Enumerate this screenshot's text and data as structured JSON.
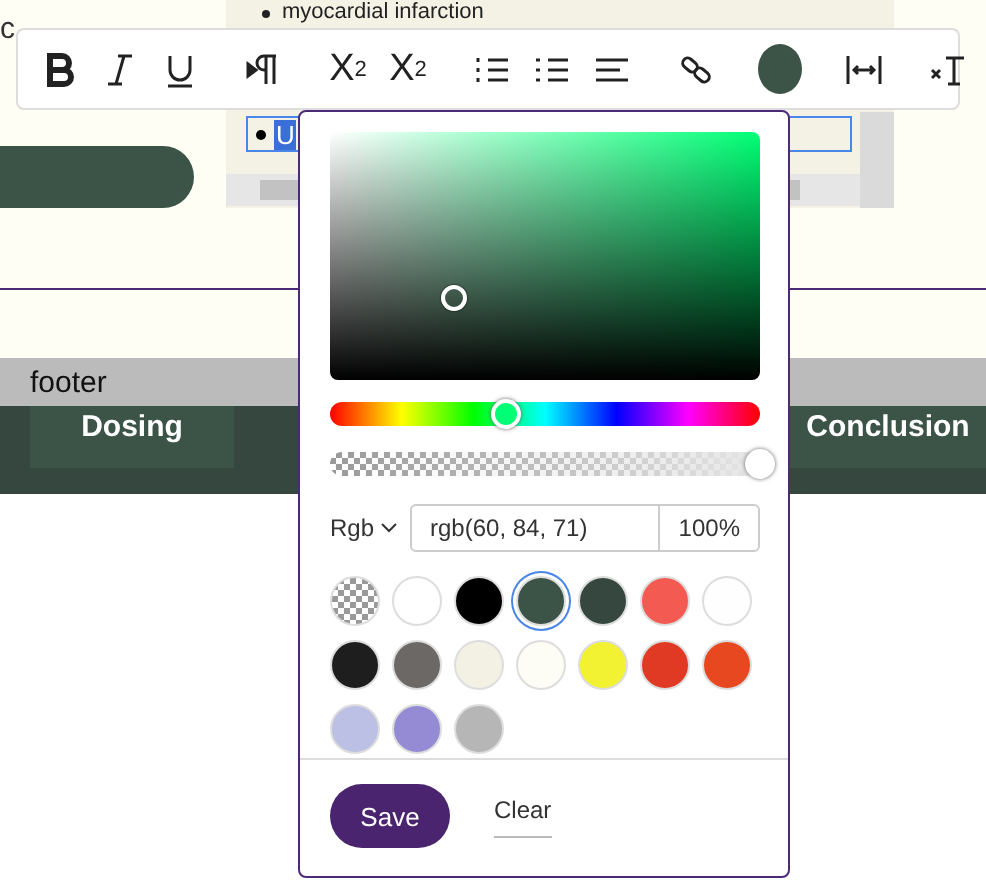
{
  "page": {
    "intro_text": "c",
    "editor": {
      "list_item": "myocardial infarction",
      "selected_text": "U"
    },
    "footer": "footer",
    "nav_tabs": [
      {
        "label": "Dosing",
        "selected": false
      },
      {
        "label": "Conclusion",
        "selected": false
      }
    ]
  },
  "toolbar": [
    {
      "kind": "bold"
    },
    {
      "kind": "italic"
    },
    {
      "kind": "underline"
    },
    {
      "kind": "sep"
    },
    {
      "kind": "paragraph"
    },
    {
      "kind": "sep"
    },
    {
      "kind": "subscript",
      "label": "X",
      "index": "2"
    },
    {
      "kind": "superscript",
      "label": "X",
      "index": "2"
    },
    {
      "kind": "sep"
    },
    {
      "kind": "ordered-list"
    },
    {
      "kind": "bullet-list"
    },
    {
      "kind": "align"
    },
    {
      "kind": "sep"
    },
    {
      "kind": "link"
    },
    {
      "kind": "sep"
    },
    {
      "kind": "color",
      "color": "#3c5447"
    },
    {
      "kind": "sep"
    },
    {
      "kind": "width"
    },
    {
      "kind": "sep"
    },
    {
      "kind": "clear-format"
    }
  ],
  "color_picker": {
    "saturation": {
      "level": 0.29
    },
    "brightness": {
      "level": 0.33
    },
    "hue": {
      "level": 0.41
    },
    "alpha": {
      "level": 1
    },
    "format": "Rgb",
    "value": "rgb(60, 84, 71)",
    "opacity": "100%",
    "swatches": [
      {
        "kind": "transparent",
        "selected": false
      },
      {
        "kind": "color",
        "color": "#ffffff",
        "selected": false
      },
      {
        "kind": "color",
        "color": "#000000",
        "selected": false
      },
      {
        "kind": "color",
        "color": "#3c5447",
        "selected": true
      },
      {
        "kind": "color",
        "color": "#36473f",
        "selected": false
      },
      {
        "kind": "color",
        "color": "#f25a52",
        "selected": false
      },
      {
        "kind": "color",
        "color": "#fefefe",
        "selected": false
      },
      {
        "kind": "color",
        "color": "#1e1e1e",
        "selected": false
      },
      {
        "kind": "color",
        "color": "#6b6866",
        "selected": false
      },
      {
        "kind": "color",
        "color": "#f3f1e4",
        "selected": false
      },
      {
        "kind": "color",
        "color": "#fdfdf5",
        "selected": false
      },
      {
        "kind": "color",
        "color": "#f2f232",
        "selected": false
      },
      {
        "kind": "color",
        "color": "#e03a24",
        "selected": false
      },
      {
        "kind": "color",
        "color": "#e8481f",
        "selected": false
      },
      {
        "kind": "color",
        "color": "#bcc0e4",
        "selected": false
      },
      {
        "kind": "color",
        "color": "#948bd4",
        "selected": false
      },
      {
        "kind": "color",
        "color": "#b6b6b6",
        "selected": false
      }
    ],
    "buttons": [
      {
        "kind": "primary",
        "label": "Save"
      },
      {
        "kind": "link",
        "label": "Clear"
      }
    ]
  }
}
